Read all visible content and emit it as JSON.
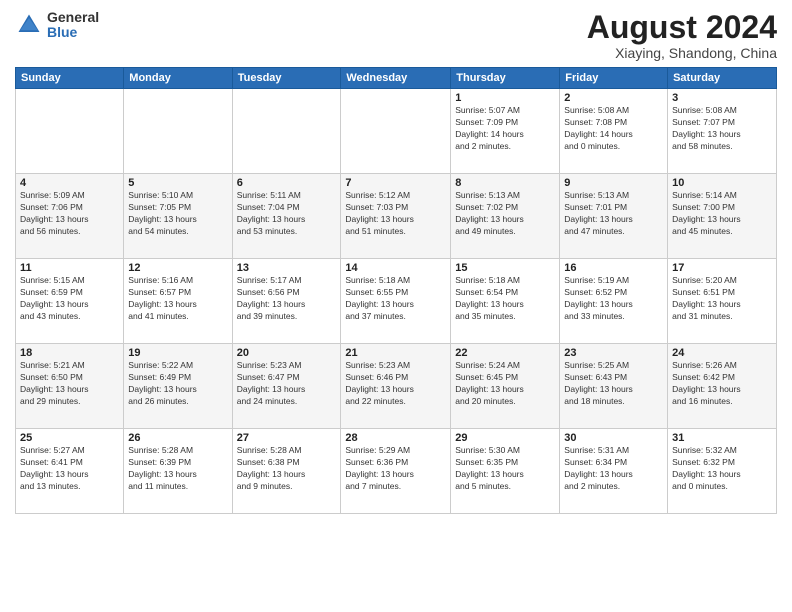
{
  "header": {
    "logo_general": "General",
    "logo_blue": "Blue",
    "month_title": "August 2024",
    "location": "Xiaying, Shandong, China"
  },
  "days_of_week": [
    "Sunday",
    "Monday",
    "Tuesday",
    "Wednesday",
    "Thursday",
    "Friday",
    "Saturday"
  ],
  "weeks": [
    [
      {
        "day": "",
        "info": ""
      },
      {
        "day": "",
        "info": ""
      },
      {
        "day": "",
        "info": ""
      },
      {
        "day": "",
        "info": ""
      },
      {
        "day": "1",
        "info": "Sunrise: 5:07 AM\nSunset: 7:09 PM\nDaylight: 14 hours\nand 2 minutes."
      },
      {
        "day": "2",
        "info": "Sunrise: 5:08 AM\nSunset: 7:08 PM\nDaylight: 14 hours\nand 0 minutes."
      },
      {
        "day": "3",
        "info": "Sunrise: 5:08 AM\nSunset: 7:07 PM\nDaylight: 13 hours\nand 58 minutes."
      }
    ],
    [
      {
        "day": "4",
        "info": "Sunrise: 5:09 AM\nSunset: 7:06 PM\nDaylight: 13 hours\nand 56 minutes."
      },
      {
        "day": "5",
        "info": "Sunrise: 5:10 AM\nSunset: 7:05 PM\nDaylight: 13 hours\nand 54 minutes."
      },
      {
        "day": "6",
        "info": "Sunrise: 5:11 AM\nSunset: 7:04 PM\nDaylight: 13 hours\nand 53 minutes."
      },
      {
        "day": "7",
        "info": "Sunrise: 5:12 AM\nSunset: 7:03 PM\nDaylight: 13 hours\nand 51 minutes."
      },
      {
        "day": "8",
        "info": "Sunrise: 5:13 AM\nSunset: 7:02 PM\nDaylight: 13 hours\nand 49 minutes."
      },
      {
        "day": "9",
        "info": "Sunrise: 5:13 AM\nSunset: 7:01 PM\nDaylight: 13 hours\nand 47 minutes."
      },
      {
        "day": "10",
        "info": "Sunrise: 5:14 AM\nSunset: 7:00 PM\nDaylight: 13 hours\nand 45 minutes."
      }
    ],
    [
      {
        "day": "11",
        "info": "Sunrise: 5:15 AM\nSunset: 6:59 PM\nDaylight: 13 hours\nand 43 minutes."
      },
      {
        "day": "12",
        "info": "Sunrise: 5:16 AM\nSunset: 6:57 PM\nDaylight: 13 hours\nand 41 minutes."
      },
      {
        "day": "13",
        "info": "Sunrise: 5:17 AM\nSunset: 6:56 PM\nDaylight: 13 hours\nand 39 minutes."
      },
      {
        "day": "14",
        "info": "Sunrise: 5:18 AM\nSunset: 6:55 PM\nDaylight: 13 hours\nand 37 minutes."
      },
      {
        "day": "15",
        "info": "Sunrise: 5:18 AM\nSunset: 6:54 PM\nDaylight: 13 hours\nand 35 minutes."
      },
      {
        "day": "16",
        "info": "Sunrise: 5:19 AM\nSunset: 6:52 PM\nDaylight: 13 hours\nand 33 minutes."
      },
      {
        "day": "17",
        "info": "Sunrise: 5:20 AM\nSunset: 6:51 PM\nDaylight: 13 hours\nand 31 minutes."
      }
    ],
    [
      {
        "day": "18",
        "info": "Sunrise: 5:21 AM\nSunset: 6:50 PM\nDaylight: 13 hours\nand 29 minutes."
      },
      {
        "day": "19",
        "info": "Sunrise: 5:22 AM\nSunset: 6:49 PM\nDaylight: 13 hours\nand 26 minutes."
      },
      {
        "day": "20",
        "info": "Sunrise: 5:23 AM\nSunset: 6:47 PM\nDaylight: 13 hours\nand 24 minutes."
      },
      {
        "day": "21",
        "info": "Sunrise: 5:23 AM\nSunset: 6:46 PM\nDaylight: 13 hours\nand 22 minutes."
      },
      {
        "day": "22",
        "info": "Sunrise: 5:24 AM\nSunset: 6:45 PM\nDaylight: 13 hours\nand 20 minutes."
      },
      {
        "day": "23",
        "info": "Sunrise: 5:25 AM\nSunset: 6:43 PM\nDaylight: 13 hours\nand 18 minutes."
      },
      {
        "day": "24",
        "info": "Sunrise: 5:26 AM\nSunset: 6:42 PM\nDaylight: 13 hours\nand 16 minutes."
      }
    ],
    [
      {
        "day": "25",
        "info": "Sunrise: 5:27 AM\nSunset: 6:41 PM\nDaylight: 13 hours\nand 13 minutes."
      },
      {
        "day": "26",
        "info": "Sunrise: 5:28 AM\nSunset: 6:39 PM\nDaylight: 13 hours\nand 11 minutes."
      },
      {
        "day": "27",
        "info": "Sunrise: 5:28 AM\nSunset: 6:38 PM\nDaylight: 13 hours\nand 9 minutes."
      },
      {
        "day": "28",
        "info": "Sunrise: 5:29 AM\nSunset: 6:36 PM\nDaylight: 13 hours\nand 7 minutes."
      },
      {
        "day": "29",
        "info": "Sunrise: 5:30 AM\nSunset: 6:35 PM\nDaylight: 13 hours\nand 5 minutes."
      },
      {
        "day": "30",
        "info": "Sunrise: 5:31 AM\nSunset: 6:34 PM\nDaylight: 13 hours\nand 2 minutes."
      },
      {
        "day": "31",
        "info": "Sunrise: 5:32 AM\nSunset: 6:32 PM\nDaylight: 13 hours\nand 0 minutes."
      }
    ]
  ]
}
